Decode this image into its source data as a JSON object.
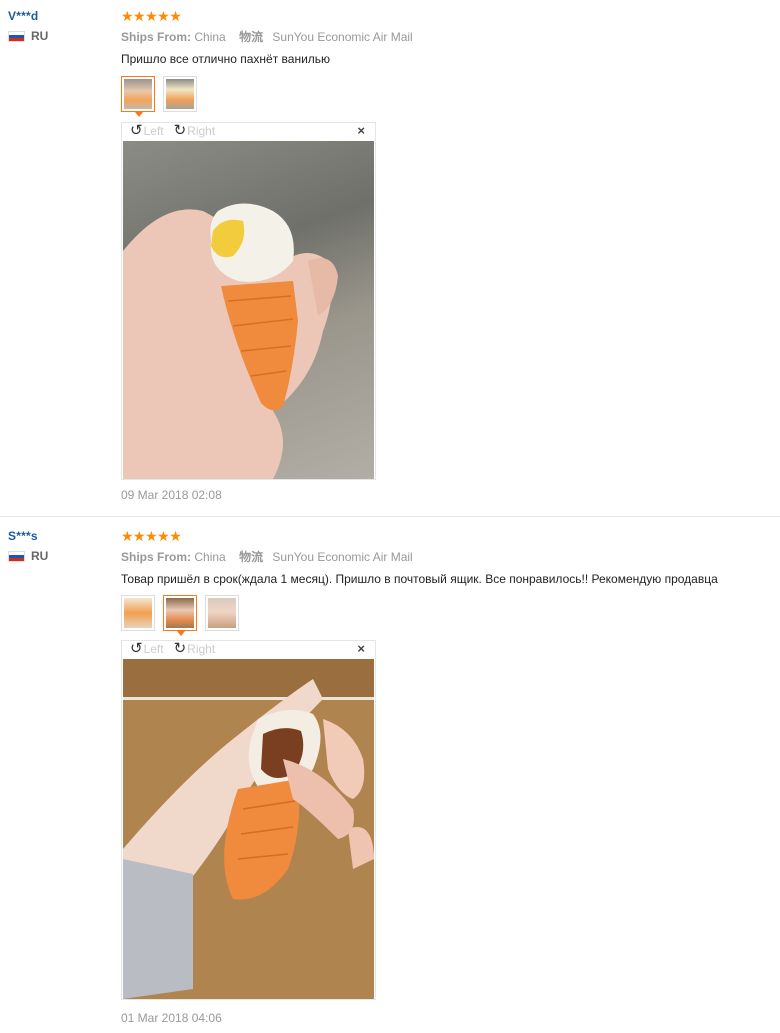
{
  "reviews": [
    {
      "user": "V***d",
      "country": "RU",
      "stars": "★★★★★",
      "ships_from_label": "Ships From:",
      "ships_from": "China",
      "logistics_label": "物流",
      "logistics": "SunYou Economic Air Mail",
      "text": "Пришло все отлично пахнёт ванилью",
      "viewer": {
        "left": "Left",
        "right": "Right",
        "close": "×"
      },
      "date": "09 Mar 2018 02:08"
    },
    {
      "user": "S***s",
      "country": "RU",
      "stars": "★★★★★",
      "ships_from_label": "Ships From:",
      "ships_from": "China",
      "logistics_label": "物流",
      "logistics": "SunYou Economic Air Mail",
      "text": "Товар пришёл в срок(ждала 1 месяц). Пришло в почтовый ящик. Все понравилось!! Рекомендую продавца",
      "viewer": {
        "left": "Left",
        "right": "Right",
        "close": "×"
      },
      "date": "01 Mar 2018 04:06"
    }
  ],
  "icons": {
    "rotate_left": "rotate-left-icon",
    "rotate_right": "rotate-right-icon",
    "close": "close-icon",
    "flag": "russia-flag-icon"
  },
  "colors": {
    "username": "#1a5a9e",
    "stars": "#ff8a00",
    "selected_thumb": "#ff7519"
  }
}
